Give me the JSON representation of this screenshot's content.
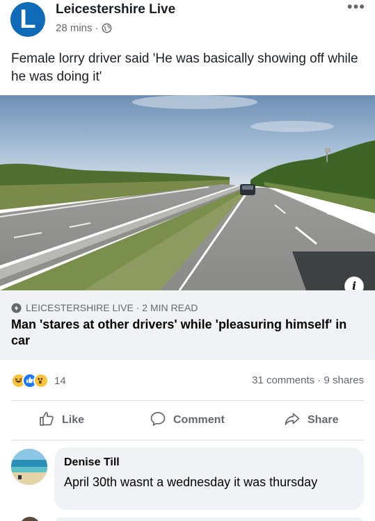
{
  "post": {
    "page_name": "Leicestershire Live",
    "time": "28 mins",
    "separator": "·",
    "privacy_icon": "globe-icon",
    "more_icon": "more-icon",
    "more_label": "•••",
    "logo_letter": "L",
    "text": "Female lorry driver said 'He was basically showing off while he was doing it'"
  },
  "link": {
    "image_icon": "info-icon",
    "info_label": "i",
    "source": "LEICESTERSHIRE LIVE · 2 MIN READ",
    "source_icon": "bolt-icon",
    "title": "Man 'stares at other drivers' while 'pleasuring himself' in car"
  },
  "stats": {
    "reaction_count": "14",
    "reactions": [
      "haha",
      "like",
      "wow"
    ],
    "comments_shares": "31 comments · 9 shares"
  },
  "actions": {
    "like": "Like",
    "comment": "Comment",
    "share": "Share"
  },
  "comment": {
    "name": "Denise Till",
    "text": "April 30th wasnt a wednesday it was thursday"
  },
  "colors": {
    "brand": "#0f6bb8",
    "secondary_text": "#65676b",
    "card_bg": "#f0f2f5"
  }
}
